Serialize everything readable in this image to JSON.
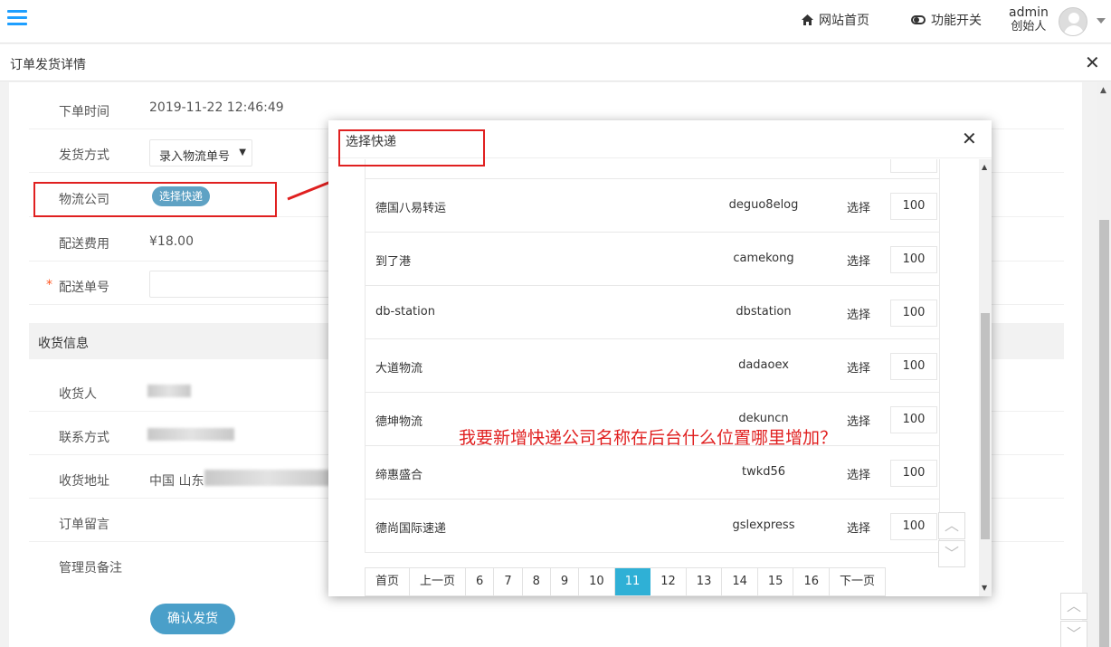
{
  "header": {
    "home_label": "网站首页",
    "feature_label": "功能开关",
    "user_name": "admin",
    "user_role": "创始人"
  },
  "page": {
    "title": "订单发货详情"
  },
  "form": {
    "order_time_label": "下单时间",
    "order_time_value": "2019-11-22 12:46:49",
    "ship_method_label": "发货方式",
    "ship_method_value": "录入物流单号",
    "logistics_label": "物流公司",
    "logistics_button": "选择快递",
    "fee_label": "配送费用",
    "fee_value": "¥18.00",
    "tracking_label": "配送单号",
    "required_mark": "*",
    "receiver_section": "收货信息",
    "receiver_label": "收货人",
    "contact_label": "联系方式",
    "address_label": "收货地址",
    "address_value": "中国 山东",
    "message_label": "订单留言",
    "admin_note_label": "管理员备注",
    "confirm_button": "确认发货"
  },
  "modal": {
    "title": "选择快递",
    "rows": [
      {
        "name": "德国八易转运",
        "code": "deguo8elog",
        "action": "选择",
        "order": "100"
      },
      {
        "name": "到了港",
        "code": "camekong",
        "action": "选择",
        "order": "100"
      },
      {
        "name": "db-station",
        "code": "dbstation",
        "action": "选择",
        "order": "100"
      },
      {
        "name": "大道物流",
        "code": "dadaoex",
        "action": "选择",
        "order": "100"
      },
      {
        "name": "德坤物流",
        "code": "dekuncn",
        "action": "选择",
        "order": "100"
      },
      {
        "name": "缔惠盛合",
        "code": "twkd56",
        "action": "选择",
        "order": "100"
      },
      {
        "name": "德尚国际速递",
        "code": "gslexpress",
        "action": "选择",
        "order": "100"
      }
    ],
    "pagination": [
      "首页",
      "上一页",
      "6",
      "7",
      "8",
      "9",
      "10",
      "11",
      "12",
      "13",
      "14",
      "15",
      "16",
      "下一页"
    ],
    "current_page": "11"
  },
  "annotation_text": "我要新增快递公司名称在后台什么位置哪里增加？",
  "colors": {
    "accent": "#2fb0d6",
    "annotation_red": "#e02020",
    "pill_blue": "#5fa2c4"
  }
}
